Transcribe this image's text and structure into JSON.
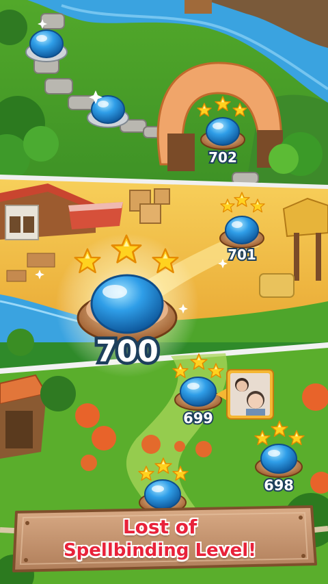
{
  "levels": {
    "lvl_702": "702",
    "lvl_701": "701",
    "lvl_700": "700",
    "lvl_699": "699",
    "lvl_698": "698"
  },
  "banner": {
    "line1": "Lost of",
    "line2": "Spellbinding Level!"
  },
  "stars_per_level": 3,
  "current_level": "700",
  "colors": {
    "river": "#3aa3e0",
    "sand": "#f4c047",
    "grass": "#5cb52f",
    "node_blue": "#2f9ee8",
    "banner_red": "#e8223a",
    "plank": "#c99a74",
    "star": "#ffd21f"
  },
  "icons": [
    "star-icon",
    "level-node-icon",
    "friend-avatar-icon"
  ]
}
